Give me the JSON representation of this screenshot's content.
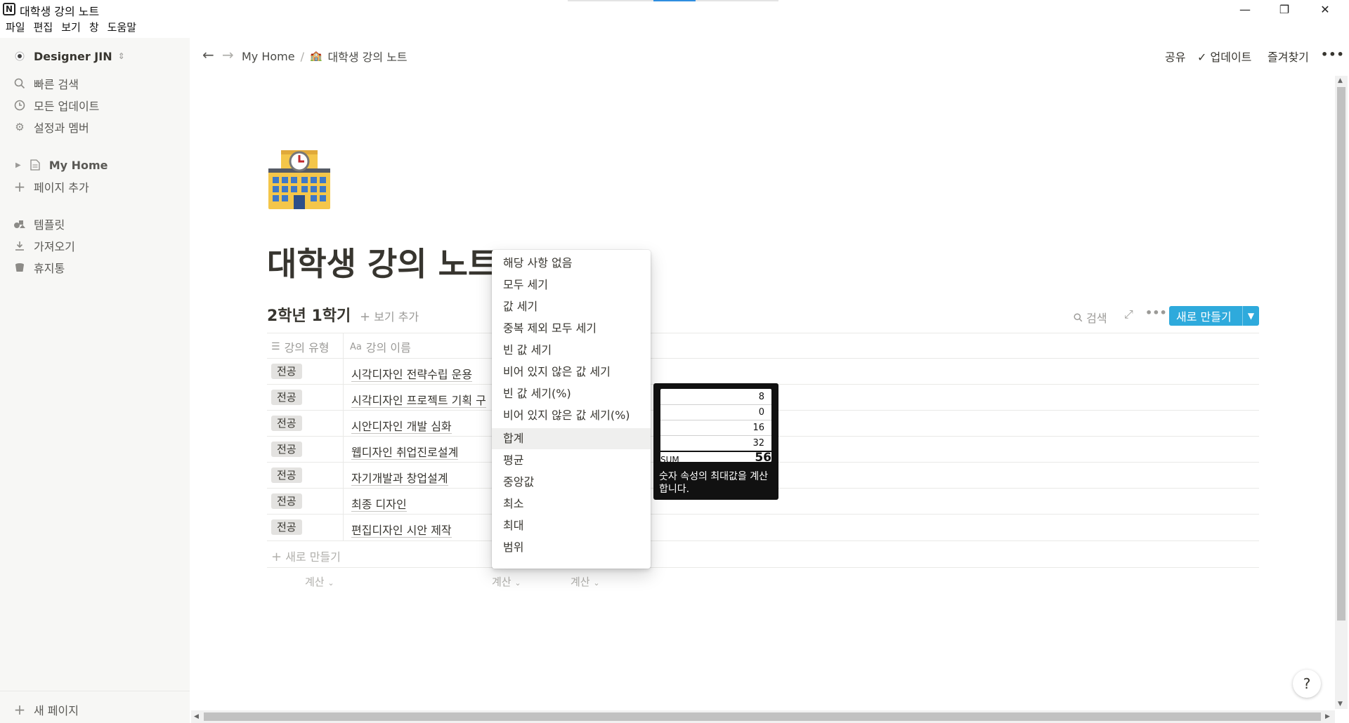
{
  "window": {
    "title": "대학생 강의 노트",
    "app_icon": "N",
    "menu": [
      "파일",
      "편집",
      "보기",
      "창",
      "도움말"
    ],
    "controls": {
      "minimize": "—",
      "restore": "❐",
      "close": "✕"
    }
  },
  "sidebar": {
    "workspace": "Designer JIN",
    "top_items": [
      {
        "label": "빠른 검색",
        "icon": "search-icon"
      },
      {
        "label": "모든 업데이트",
        "icon": "clock-icon"
      },
      {
        "label": "설정과 멤버",
        "icon": "gear-icon"
      }
    ],
    "pages": [
      {
        "label": "My Home",
        "icon": "page-icon"
      },
      {
        "label": "페이지 추가",
        "icon": "plus-icon"
      }
    ],
    "bottom_items": [
      {
        "label": "템플릿",
        "icon": "template-icon"
      },
      {
        "label": "가져오기",
        "icon": "download-icon"
      },
      {
        "label": "휴지통",
        "icon": "trash-icon"
      }
    ],
    "new_page": "새 페이지"
  },
  "topbar": {
    "breadcrumb": [
      "My Home",
      "대학생 강의 노트"
    ],
    "share": "공유",
    "updates": "업데이트",
    "favorites": "즐겨찾기",
    "more": "•••"
  },
  "page": {
    "title": "대학생 강의 노트",
    "view_title": "2학년 1학기",
    "add_view": "보기 추가",
    "search": "검색",
    "new_button": "새로 만들기",
    "columns": [
      "강의 유형",
      "강의 이름"
    ],
    "rows": [
      {
        "type": "전공",
        "name": "시각디자인 전략수립 운용"
      },
      {
        "type": "전공",
        "name": "시각디자인 프로젝트 기획 구"
      },
      {
        "type": "전공",
        "name": "시안디자인 개발 심화"
      },
      {
        "type": "전공",
        "name": "웹디자인 취업진로설계"
      },
      {
        "type": "전공",
        "name": "자기개발과 창업설계"
      },
      {
        "type": "전공",
        "name": "최종 디자인"
      },
      {
        "type": "전공",
        "name": "편집디자인 시안 제작"
      }
    ],
    "new_row": "새로 만들기",
    "calc_label": "계산"
  },
  "calc_menu": {
    "items": [
      "해당 사항 없음",
      "모두 세기",
      "값 세기",
      "중복 제외 모두 세기",
      "빈 값 세기",
      "비어 있지 않은 값 세기",
      "빈 값 세기(%)",
      "비어 있지 않은 값 세기(%)",
      "합계",
      "평균",
      "중앙값",
      "최소",
      "최대",
      "범위"
    ],
    "highlighted": "합계"
  },
  "tooltip": {
    "values": [
      "8",
      "0",
      "16",
      "32"
    ],
    "sum_label": "SUM",
    "sum_value": "56",
    "description": "숫자 속성의 최대값을 계산합니다."
  },
  "help": "?"
}
